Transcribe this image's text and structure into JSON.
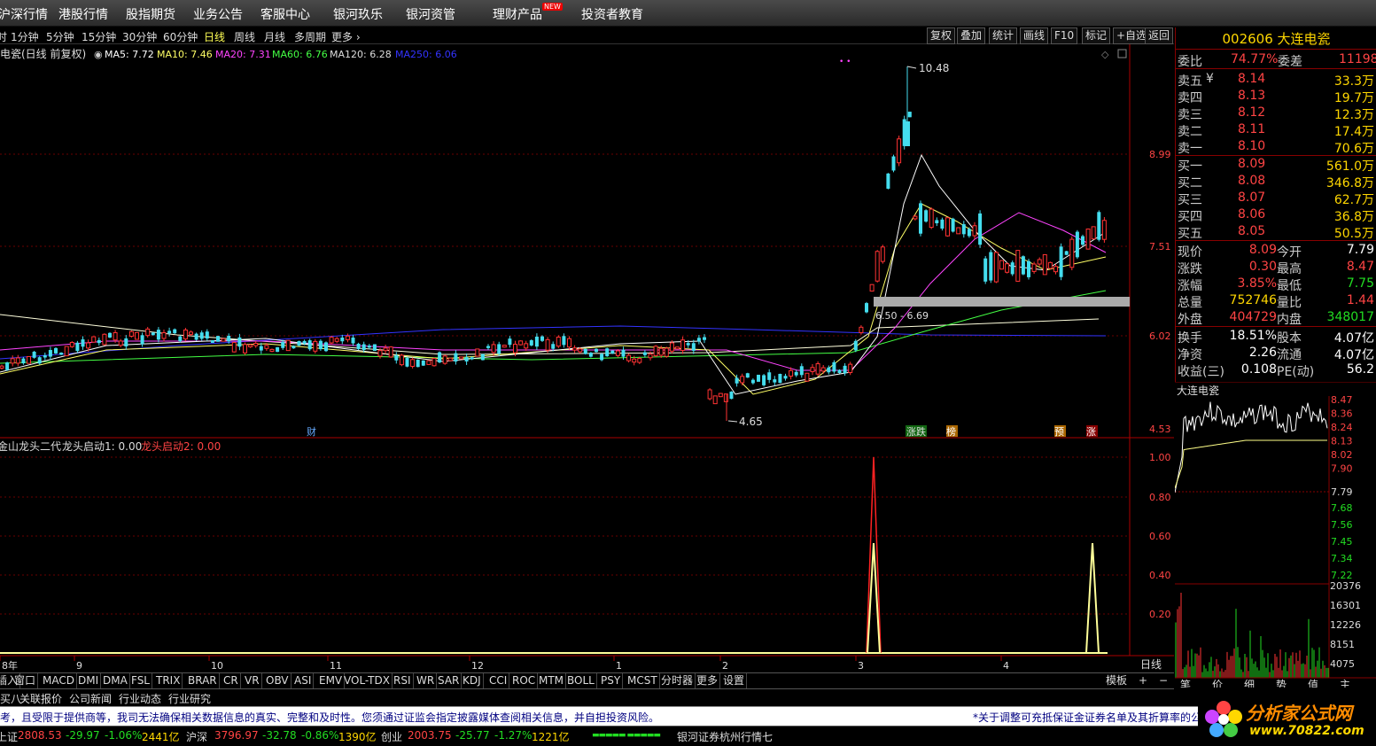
{
  "top_menu": [
    "沪深行情",
    "港股行情",
    "股指期货",
    "业务公告",
    "客服中心",
    "银河玖乐",
    "银河资管",
    "理财产品",
    "投资者教育"
  ],
  "new_badge": "NEW",
  "periods": [
    "时",
    "1分钟",
    "5分钟",
    "15分钟",
    "30分钟",
    "60分钟",
    "日线",
    "周线",
    "月线",
    "多周期",
    "更多 ›"
  ],
  "active_period": "日线",
  "toolbar": [
    "复权",
    "叠加",
    "统计",
    "画线",
    "F10",
    "标记",
    "+自选",
    "返回"
  ],
  "legend": {
    "title": "电瓷(日线 前复权)",
    "items": [
      {
        "t": "MA5: 7.72",
        "c": "#ffffff"
      },
      {
        "t": "MA10: 7.46",
        "c": "#ffff66"
      },
      {
        "t": "MA20: 7.31",
        "c": "#ff44ff"
      },
      {
        "t": "MA60: 6.76",
        "c": "#44ff44"
      },
      {
        "t": "MA120: 6.28",
        "c": "#dddddd"
      },
      {
        "t": "MA250: 6.06",
        "c": "#3333ff"
      }
    ]
  },
  "annotations": {
    "high": "10.48",
    "low": "4.65",
    "box": "6.50 - 6.69",
    "cai": "财"
  },
  "event_markers": [
    "涨跌",
    "榜",
    "预",
    "涨"
  ],
  "indicator": {
    "name": "金山龙头二代",
    "l1": "龙头启动1: 0.00",
    "l2": "龙头启动2: 0.00"
  },
  "price_ticks": [
    "8.99",
    "7.51",
    "6.02",
    "4.53"
  ],
  "ind_ticks": [
    "1.00",
    "0.80",
    "0.60",
    "0.40",
    "0.20"
  ],
  "x_labels": [
    "8年",
    "9",
    "10",
    "11",
    "12",
    "1",
    "2",
    "3",
    "4"
  ],
  "daily_label": "日线",
  "quote": {
    "code": "002606 大连电瓷",
    "weibi_label": "委比",
    "weibi": "74.77%",
    "weicha_label": "委差",
    "weicha": "11198",
    "asks": [
      {
        "l": "卖五",
        "m": "¥",
        "p": "8.14",
        "v": "33.3万"
      },
      {
        "l": "卖四",
        "m": "",
        "p": "8.13",
        "v": "19.7万"
      },
      {
        "l": "卖三",
        "m": "",
        "p": "8.12",
        "v": "12.3万"
      },
      {
        "l": "卖二",
        "m": "",
        "p": "8.11",
        "v": "17.4万"
      },
      {
        "l": "卖一",
        "m": "",
        "p": "8.10",
        "v": "70.6万"
      }
    ],
    "bids": [
      {
        "l": "买一",
        "p": "8.09",
        "v": "561.0万"
      },
      {
        "l": "买二",
        "p": "8.08",
        "v": "346.8万"
      },
      {
        "l": "买三",
        "p": "8.07",
        "v": "62.7万"
      },
      {
        "l": "买四",
        "p": "8.06",
        "v": "36.8万"
      },
      {
        "l": "买五",
        "p": "8.05",
        "v": "50.5万"
      }
    ],
    "stats": [
      {
        "l1": "现价",
        "v1": "8.09",
        "c1": "red",
        "l2": "今开",
        "v2": "7.79",
        "c2": "wht"
      },
      {
        "l1": "涨跌",
        "v1": "0.30",
        "c1": "red",
        "l2": "最高",
        "v2": "8.47",
        "c2": "red"
      },
      {
        "l1": "涨幅",
        "v1": "3.85%",
        "c1": "red",
        "l2": "最低",
        "v2": "7.75",
        "c2": "grn"
      },
      {
        "l1": "总量",
        "v1": "752746",
        "c1": "yel",
        "l2": "量比",
        "v2": "1.44",
        "c2": "red"
      },
      {
        "l1": "外盘",
        "v1": "404729",
        "c1": "red",
        "l2": "内盘",
        "v2": "348017",
        "c2": "grn"
      }
    ],
    "stats2": [
      {
        "l1": "换手",
        "v1": "18.51%",
        "l2": "股本",
        "v2": "4.07亿"
      },
      {
        "l1": "净资",
        "v1": "2.26",
        "l2": "流通",
        "v2": "4.07亿"
      },
      {
        "l1": "收益(三)",
        "v1": "0.108",
        "l2": "PE(动)",
        "v2": "56.2"
      }
    ]
  },
  "mini": {
    "title": "大连电瓷",
    "price_ticks_red": [
      "8.47",
      "8.36",
      "8.24",
      "8.13",
      "8.02",
      "7.90"
    ],
    "mid": "7.79",
    "price_ticks_grn": [
      "7.68",
      "7.56",
      "7.45",
      "7.34",
      "7.22"
    ],
    "vol_ticks": [
      "20376",
      "16301",
      "12226",
      "8151",
      "4075"
    ],
    "tabs": [
      "笔",
      "价",
      "细",
      "势",
      "值",
      "主"
    ]
  },
  "ind_tabs": [
    "插入",
    "窗口",
    "MACD",
    "DMI",
    "DMA",
    "FSL",
    "TRIX",
    "BRAR",
    "CR",
    "VR",
    "OBV",
    "ASI",
    "EMV",
    "VOL-TDX",
    "RSI",
    "WR",
    "SAR",
    "KDJ",
    "CCI",
    "ROC",
    "MTM",
    "BOLL",
    "PSY",
    "MCST",
    "分时器",
    "更多",
    "设置"
  ],
  "tabs_right": [
    "模板",
    "+",
    "−"
  ],
  "info_tabs": [
    "关联报价",
    "公司新闻",
    "行业动态",
    "行业研究"
  ],
  "notice_left": "考，且受限于提供商等，我司无法确保相关数据信息的真实、完整和及时性。您须通过证监会指定披露媒体查阅相关信息，并自担投资风险。",
  "notice_right": "*关于调整可充抵保证金证券名单及其折算率的公告",
  "status": [
    {
      "n": "上证",
      "p": "2808.53",
      "c": "-29.97",
      "pc": "-1.06%",
      "a": "2441亿"
    },
    {
      "n": "沪深",
      "p": "3796.97",
      "c": "-32.78",
      "pc": "-0.86%",
      "a": "1390亿"
    },
    {
      "n": "创业",
      "p": "2003.75",
      "c": "-25.77",
      "pc": "-1.27%",
      "a": "1221亿"
    }
  ],
  "status_right": "银河证券杭州行情七",
  "logo": {
    "t1": "分析家公式网",
    "t2": "www.70822.com"
  }
}
